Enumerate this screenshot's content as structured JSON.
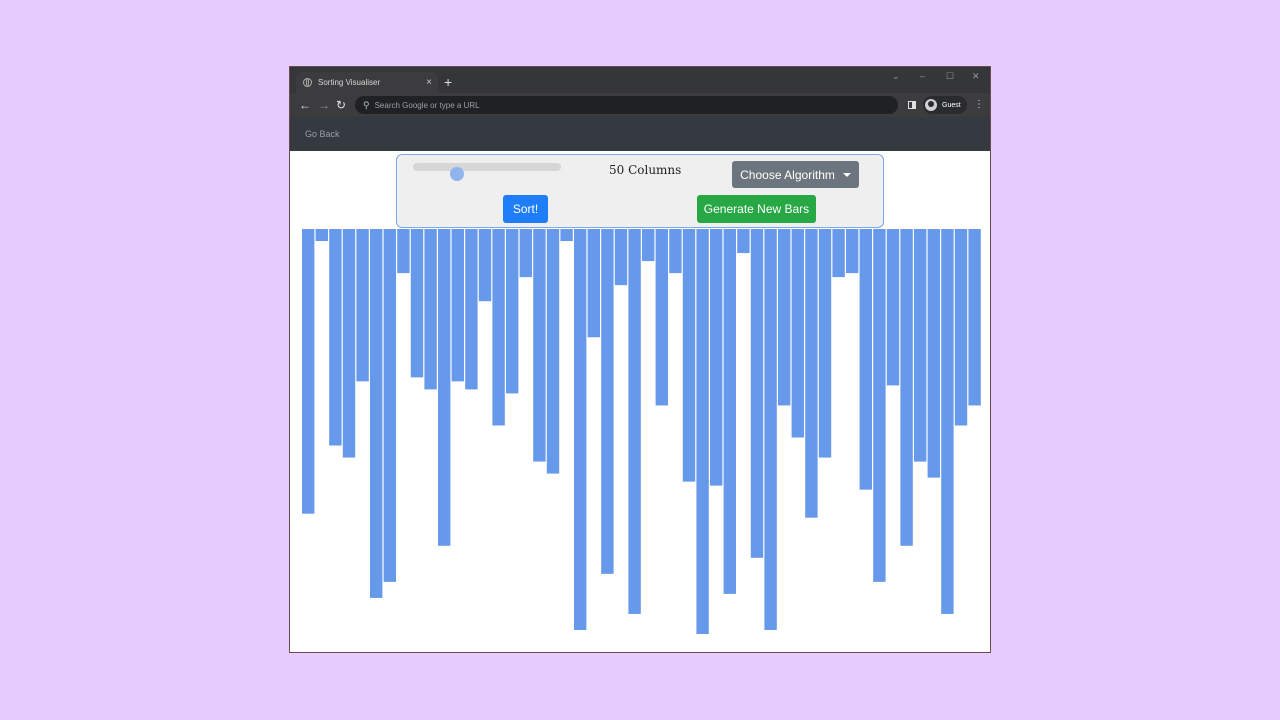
{
  "browser": {
    "tab_title": "Sorting Visualiser",
    "tab_close": "×",
    "new_tab": "+",
    "address_placeholder": "Search Google or type a URL",
    "profile_label": "Guest",
    "icons": [
      "globe-icon",
      "back-arrow-icon",
      "forward-arrow-icon",
      "reload-icon",
      "search-icon",
      "side-panel-icon",
      "profile-icon",
      "more-menu-icon"
    ]
  },
  "navbar": {
    "go_back": "Go Back"
  },
  "controls": {
    "columns_label": "50 Columns",
    "algorithm_label": "Choose Algorithm",
    "sort_label": "Sort!",
    "generate_label": "Generate New Bars",
    "slider_value_fraction": 0.3
  },
  "colors": {
    "bar": "#6699e9",
    "sort_button": "#1f7ef7",
    "generate_button": "#28a745",
    "algorithm_button": "#6c757d"
  },
  "bars": {
    "count": 50,
    "heights": [
      71,
      3,
      54,
      57,
      38,
      92,
      88,
      11,
      37,
      40,
      79,
      38,
      40,
      18,
      49,
      41,
      12,
      58,
      61,
      3,
      100,
      27,
      86,
      14,
      96,
      8,
      44,
      11,
      63,
      101,
      64,
      91,
      6,
      82,
      100,
      44,
      52,
      72,
      57,
      12,
      11,
      65,
      88,
      39,
      79,
      58,
      62,
      96,
      49,
      44
    ]
  }
}
